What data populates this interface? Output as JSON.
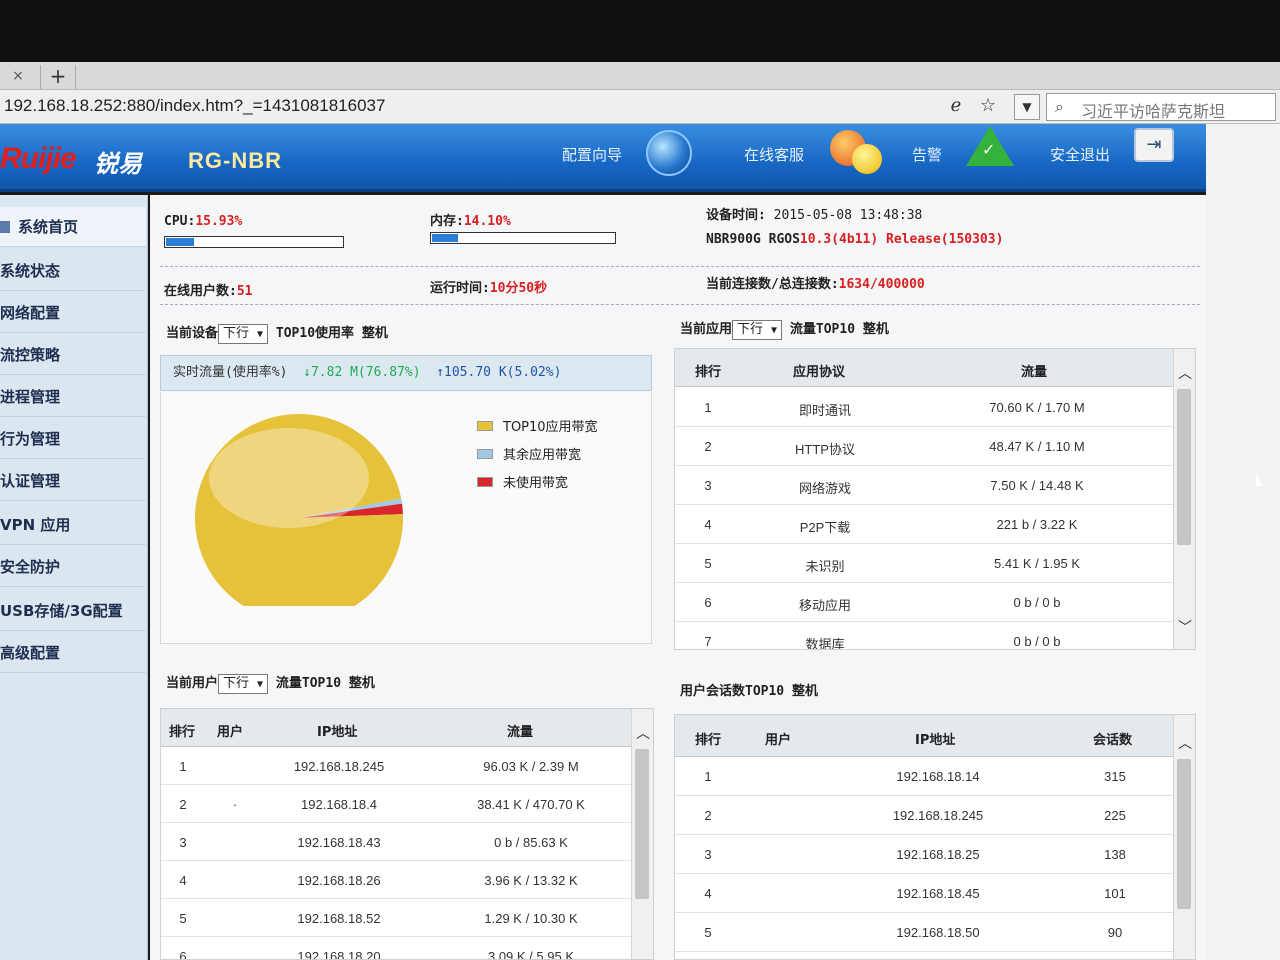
{
  "browser": {
    "tab_close": "×",
    "tab_new": "+",
    "url": "192.168.18.252:880/index.htm?_=1431081816037",
    "search_text": "习近平访哈萨克斯坦"
  },
  "header": {
    "logo": "Ruijie",
    "logo_cn": "锐易",
    "model": "RG-NBR",
    "links": {
      "wizard": "配置向导",
      "service": "在线客服",
      "alarm": "告警",
      "logout": "安全退出"
    }
  },
  "sidebar": {
    "items": [
      {
        "label": "系统首页"
      },
      {
        "label": "系统状态"
      },
      {
        "label": "网络配置"
      },
      {
        "label": "流控策略"
      },
      {
        "label": "进程管理"
      },
      {
        "label": "行为管理"
      },
      {
        "label": "认证管理"
      },
      {
        "label": "VPN 应用"
      },
      {
        "label": "安全防护"
      },
      {
        "label": "USB存储/3G配置"
      },
      {
        "label": "高级配置"
      }
    ]
  },
  "status": {
    "cpu_label": "CPU:",
    "cpu_value": "15.93%",
    "cpu_fraction": 0.1593,
    "mem_label": "内存:",
    "mem_value": "14.10%",
    "mem_fraction": 0.141,
    "device_time_label": "设备时间:",
    "device_time": "2015-05-08 13:48:38",
    "device_model": "NBR900G RGOS",
    "device_version": "10.3(4b11) Release(150303)",
    "online_users_label": "在线用户数:",
    "online_users": "51",
    "uptime_label": "运行时间:",
    "uptime": "10分50秒",
    "conn_label": "当前连接数/总连接数:",
    "conn_value": "1634/400000"
  },
  "device_panel": {
    "prefix": "当前设备",
    "select": "下行",
    "suffix": "TOP10使用率 整机",
    "flow_label": "实时流量(使用率%)",
    "down": "↓7.82  M(76.87%)",
    "up": "↑105.70  K(5.02%)",
    "legend": [
      {
        "label": "TOP10应用带宽",
        "color": "#e6c13a"
      },
      {
        "label": "其余应用带宽",
        "color": "#9fc9e4"
      },
      {
        "label": "未使用带宽",
        "color": "#d8262a"
      }
    ],
    "chart_data": {
      "type": "pie",
      "labels": [
        "TOP10应用带宽",
        "其余应用带宽",
        "未使用带宽"
      ],
      "values": [
        97.6,
        0.8,
        1.6
      ]
    }
  },
  "app_panel": {
    "prefix": "当前应用",
    "select": "下行",
    "suffix": "流量TOP10 整机",
    "headers": [
      "排行",
      "应用协议",
      "流量"
    ],
    "rows": [
      {
        "rank": "1",
        "proto": "即时通讯",
        "flow": "70.60 K / 1.70 M"
      },
      {
        "rank": "2",
        "proto": "HTTP协议",
        "flow": "48.47 K / 1.10 M"
      },
      {
        "rank": "3",
        "proto": "网络游戏",
        "flow": "7.50 K / 14.48 K"
      },
      {
        "rank": "4",
        "proto": "P2P下载",
        "flow": "221 b / 3.22 K"
      },
      {
        "rank": "5",
        "proto": "未识别",
        "flow": "5.41 K / 1.95 K"
      },
      {
        "rank": "6",
        "proto": "移动应用",
        "flow": "0 b / 0 b"
      },
      {
        "rank": "7",
        "proto": "数据库",
        "flow": "0 b / 0 b"
      }
    ]
  },
  "user_panel": {
    "prefix": "当前用户",
    "select": "下行",
    "suffix": "流量TOP10 整机",
    "headers": [
      "排行",
      "用户",
      "IP地址",
      "流量"
    ],
    "rows": [
      {
        "rank": "1",
        "user": "",
        "ip": "192.168.18.245",
        "flow": "96.03 K / 2.39 M"
      },
      {
        "rank": "2",
        "user": "·",
        "ip": "192.168.18.4",
        "flow": "38.41 K / 470.70 K"
      },
      {
        "rank": "3",
        "user": "",
        "ip": "192.168.18.43",
        "flow": "0 b / 85.63 K"
      },
      {
        "rank": "4",
        "user": "",
        "ip": "192.168.18.26",
        "flow": "3.96 K / 13.32 K"
      },
      {
        "rank": "5",
        "user": "",
        "ip": "192.168.18.52",
        "flow": "1.29 K / 10.30 K"
      },
      {
        "rank": "6",
        "user": "",
        "ip": "192.168.18.20",
        "flow": "3.09 K / 5.95 K"
      }
    ]
  },
  "session_panel": {
    "title": "用户会话数TOP10 整机",
    "headers": [
      "排行",
      "用户",
      "IP地址",
      "会话数"
    ],
    "rows": [
      {
        "rank": "1",
        "user": "",
        "ip": "192.168.18.14",
        "count": "315"
      },
      {
        "rank": "2",
        "user": "",
        "ip": "192.168.18.245",
        "count": "225"
      },
      {
        "rank": "3",
        "user": "",
        "ip": "192.168.18.25",
        "count": "138"
      },
      {
        "rank": "4",
        "user": "",
        "ip": "192.168.18.45",
        "count": "101"
      },
      {
        "rank": "5",
        "user": "",
        "ip": "192.168.18.50",
        "count": "90"
      }
    ]
  }
}
